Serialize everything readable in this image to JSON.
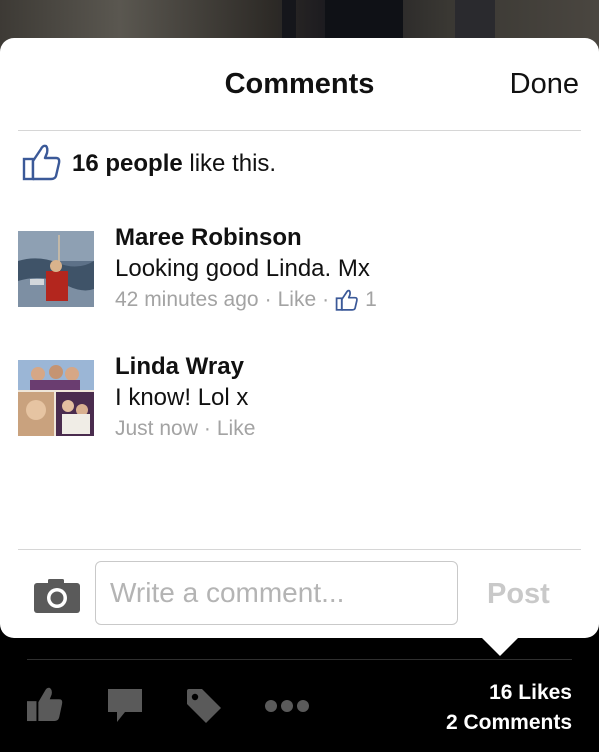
{
  "header": {
    "title": "Comments",
    "done_label": "Done"
  },
  "likes": {
    "count_label": "16 people",
    "suffix": "like this.",
    "icon": "thumbs-up-icon"
  },
  "comments": [
    {
      "author": "Maree Robinson",
      "text": "Looking good Linda. Mx",
      "time": "42 minutes ago",
      "like_label": "Like",
      "like_count": "1"
    },
    {
      "author": "Linda Wray",
      "text": "I know! Lol x",
      "time": "Just now",
      "like_label": "Like"
    }
  ],
  "composer": {
    "placeholder": "Write a comment...",
    "post_label": "Post",
    "camera_icon": "camera-icon"
  },
  "toolbar": {
    "icons": [
      "like-icon",
      "comment-icon",
      "tag-icon",
      "more-icon"
    ],
    "likes_label": "16 Likes",
    "comments_label": "2 Comments"
  },
  "colors": {
    "card_bg": "#ffffff",
    "fb_blue": "#3b5998",
    "toolbar_bg": "#000000",
    "meta_gray": "#a3a3a3"
  }
}
